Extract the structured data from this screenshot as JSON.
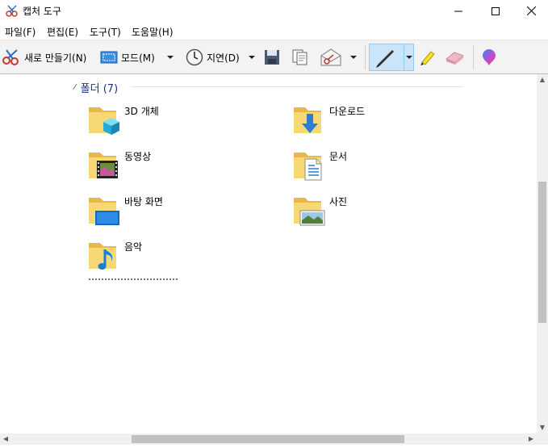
{
  "window": {
    "title": "캡처 도구"
  },
  "menu": {
    "file": "파일(F)",
    "edit": "편집(E)",
    "tools": "도구(T)",
    "help": "도움말(H)"
  },
  "toolbar": {
    "new_label": "새로 만들기(N)",
    "mode_label": "모드(M)",
    "delay_label": "지연(D)"
  },
  "group": {
    "title": "폴더 (7)"
  },
  "folders": [
    {
      "name": "3D 개체",
      "icon": "3d-objects-folder-icon"
    },
    {
      "name": "다운로드",
      "icon": "downloads-folder-icon"
    },
    {
      "name": "동영상",
      "icon": "videos-folder-icon"
    },
    {
      "name": "문서",
      "icon": "documents-folder-icon"
    },
    {
      "name": "바탕 화면",
      "icon": "desktop-folder-icon"
    },
    {
      "name": "사진",
      "icon": "pictures-folder-icon"
    },
    {
      "name": "음악",
      "icon": "music-folder-icon"
    }
  ],
  "colors": {
    "accent": "#1e3287",
    "folder": "#f8d775",
    "pen_selected": "#cce4f7"
  }
}
